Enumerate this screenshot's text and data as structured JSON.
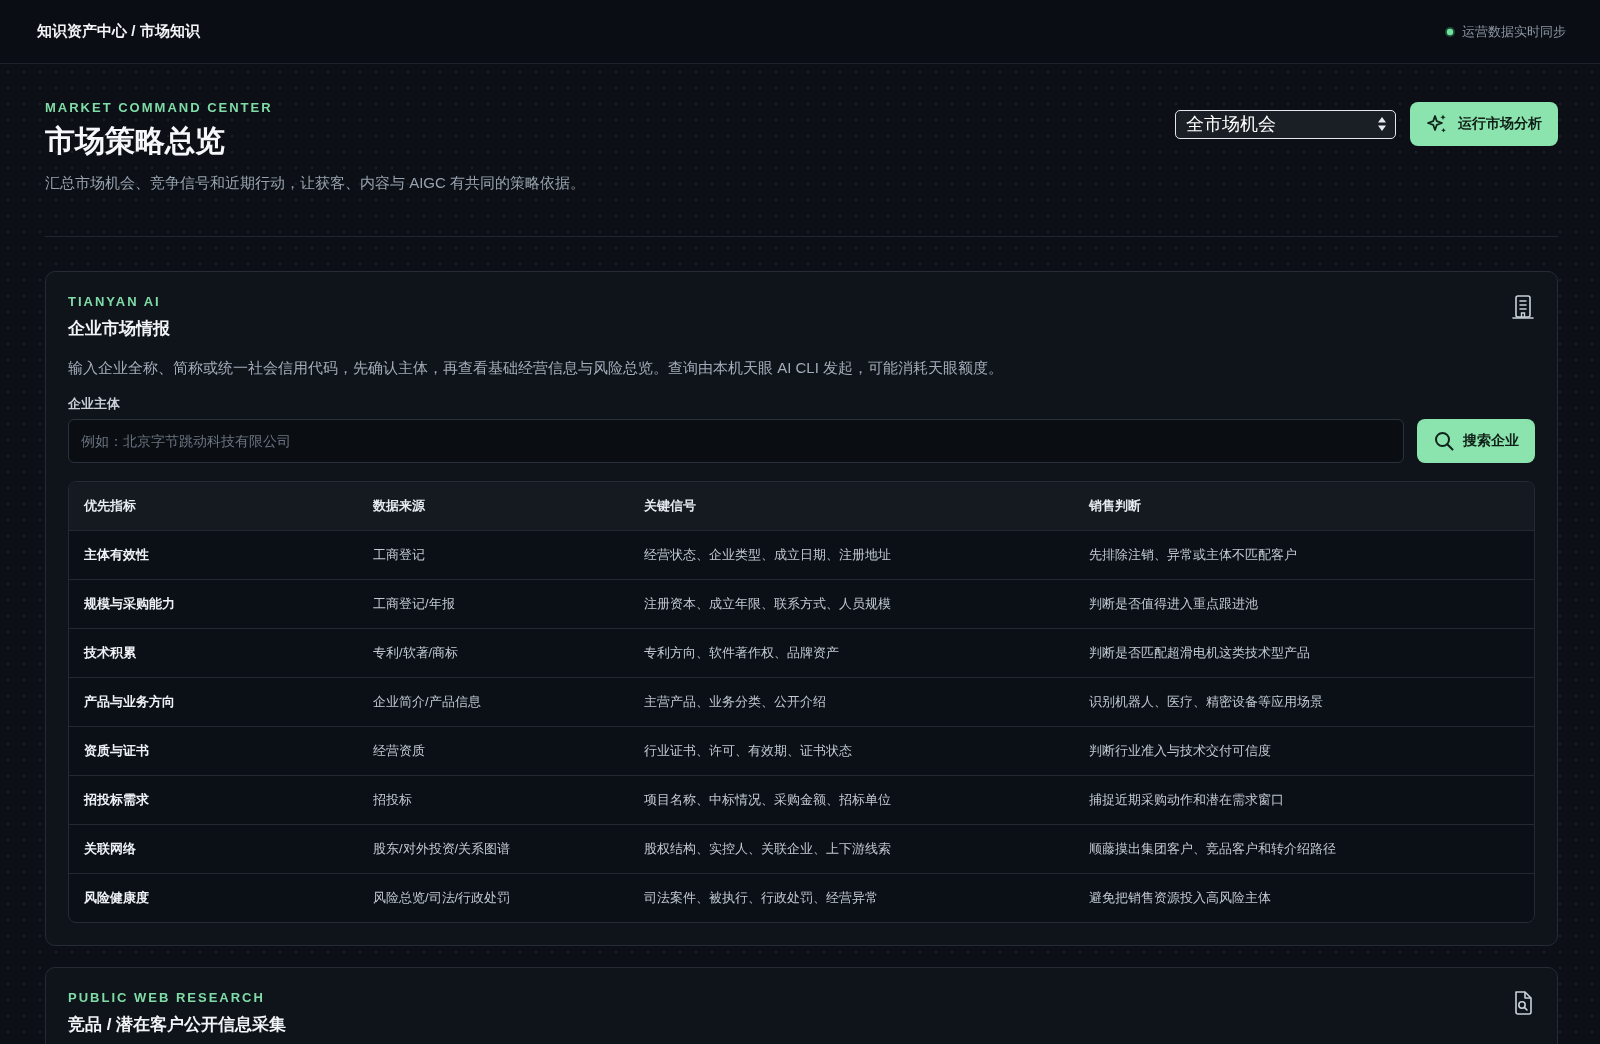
{
  "top_bar": {
    "breadcrumb": "知识资产中心 / 市场知识",
    "sync_status": "运营数据实时同步"
  },
  "header": {
    "eyebrow": "MARKET COMMAND CENTER",
    "title": "市场策略总览",
    "subtitle": "汇总市场机会、竞争信号和近期行动，让获客、内容与 AIGC 有共同的策略依据。",
    "scope_select": {
      "value": "全市场机会"
    },
    "run_button": {
      "label": "运行市场分析"
    }
  },
  "cards": [
    {
      "kind": "enterprise",
      "eyebrow": "TIANYAN AI",
      "title": "企业市场情报",
      "description": "输入企业全称、简称或统一社会信用代码，先确认主体，再查看基础经营信息与风险总览。查询由本机天眼 AI CLI 发起，可能消耗天眼额度。",
      "field": {
        "label": "企业主体",
        "placeholder": "例如：北京字节跳动科技有限公司"
      },
      "search_button": {
        "label": "搜索企业"
      },
      "table": {
        "columns": [
          "优先指标",
          "数据来源",
          "关键信号",
          "销售判断"
        ],
        "rows": [
          [
            "主体有效性",
            "工商登记",
            "经营状态、企业类型、成立日期、注册地址",
            "先排除注销、异常或主体不匹配客户"
          ],
          [
            "规模与采购能力",
            "工商登记/年报",
            "注册资本、成立年限、联系方式、人员规模",
            "判断是否值得进入重点跟进池"
          ],
          [
            "技术积累",
            "专利/软著/商标",
            "专利方向、软件著作权、品牌资产",
            "判断是否匹配超滑电机这类技术型产品"
          ],
          [
            "产品与业务方向",
            "企业简介/产品信息",
            "主营产品、业务分类、公开介绍",
            "识别机器人、医疗、精密设备等应用场景"
          ],
          [
            "资质与证书",
            "经营资质",
            "行业证书、许可、有效期、证书状态",
            "判断行业准入与技术交付可信度"
          ],
          [
            "招投标需求",
            "招投标",
            "项目名称、中标情况、采购金额、招标单位",
            "捕捉近期采购动作和潜在需求窗口"
          ],
          [
            "关联网络",
            "股东/对外投资/关系图谱",
            "股权结构、实控人、关联企业、上下游线索",
            "顺藤摸出集团客户、竞品客户和转介绍路径"
          ],
          [
            "风险健康度",
            "风险总览/司法/行政处罚",
            "司法案件、被执行、行政处罚、经营异常",
            "避免把销售资源投入高风险主体"
          ]
        ]
      }
    },
    {
      "kind": "web_research",
      "eyebrow": "PUBLIC WEB RESEARCH",
      "title": "竞品 / 潜在客户公开信息采集"
    }
  ]
}
